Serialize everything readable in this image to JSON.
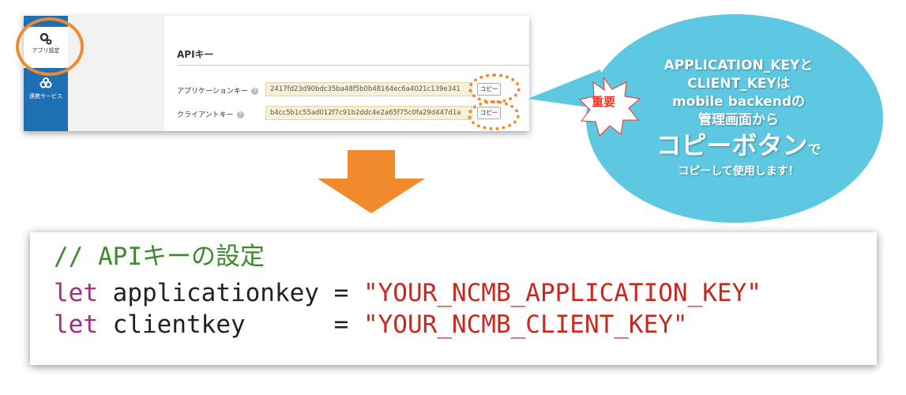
{
  "panel": {
    "sidebar": {
      "items": [
        {
          "label": "アプリ設定",
          "icon": "gears-icon",
          "active": true
        },
        {
          "label": "連携サービス",
          "icon": "link-icon",
          "active": false
        }
      ]
    },
    "api_section_title": "APIキー",
    "rows": [
      {
        "label": "アプリケーションキー",
        "help": "?",
        "value": "2417fd23d90bdc35ba48f5b0b48164ec6a4021c139e341",
        "copy_label": "コピー"
      },
      {
        "label": "クライアントキー",
        "help": "?",
        "value": "b4cc5b1c55ad012f7c91b2ddc4e2a65f75c0fa29d447d1a",
        "copy_label": "コピー"
      }
    ]
  },
  "bubble": {
    "badge": "重要",
    "line1": "APPLICATION_KEYと",
    "line2": "CLIENT_KEYは",
    "line3": "mobile backendの",
    "line4": "管理画面から",
    "line5_big": "コピーボタン",
    "line5_small": "で",
    "line6": "コピーして使用します！"
  },
  "code": {
    "comment": "// APIキーの設定",
    "line2": {
      "kw": "let",
      "ident": "applicationkey",
      "op": "=",
      "str": "\"YOUR_NCMB_APPLICATION_KEY\""
    },
    "line3": {
      "kw": "let",
      "ident": "clientkey     ",
      "op": "=",
      "str": "\"YOUR_NCMB_CLIENT_KEY\""
    }
  },
  "colors": {
    "accent_orange": "#f08a2c",
    "bubble_cyan": "#5ec8e3",
    "sidebar_blue": "#1f6fb3",
    "badge_red": "#e8332a"
  }
}
